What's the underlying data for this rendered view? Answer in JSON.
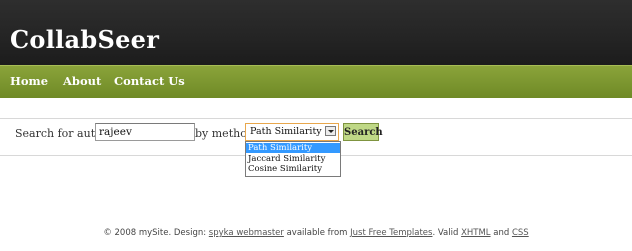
{
  "header": {
    "site_title": "CollabSeer"
  },
  "nav": {
    "items": [
      {
        "label": "Home"
      },
      {
        "label": "About"
      },
      {
        "label": "Contact Us"
      }
    ]
  },
  "search": {
    "author_label": "Search for author",
    "author_value": "rajeev",
    "method_label": "by method",
    "method_selected": "Path Similarity",
    "method_options": [
      "Path Similarity",
      "Jaccard Similarity",
      "Cosine Similarity"
    ],
    "button_label": "Search"
  },
  "footer": {
    "copyright": "© 2008 mySite. Design:",
    "designer_link": "spyka webmaster",
    "available_text": "available from",
    "templates_link": "Just Free Templates",
    "valid_text": ". Valid",
    "xhtml_link": "XHTML",
    "and_text": "and",
    "css_link": "CSS"
  },
  "colors": {
    "header_bg": "#262626",
    "nav_bg": "#7d9830",
    "button_bg": "#bfd886",
    "selected_option_bg": "#3399ff",
    "select_border": "#e8a74c"
  }
}
